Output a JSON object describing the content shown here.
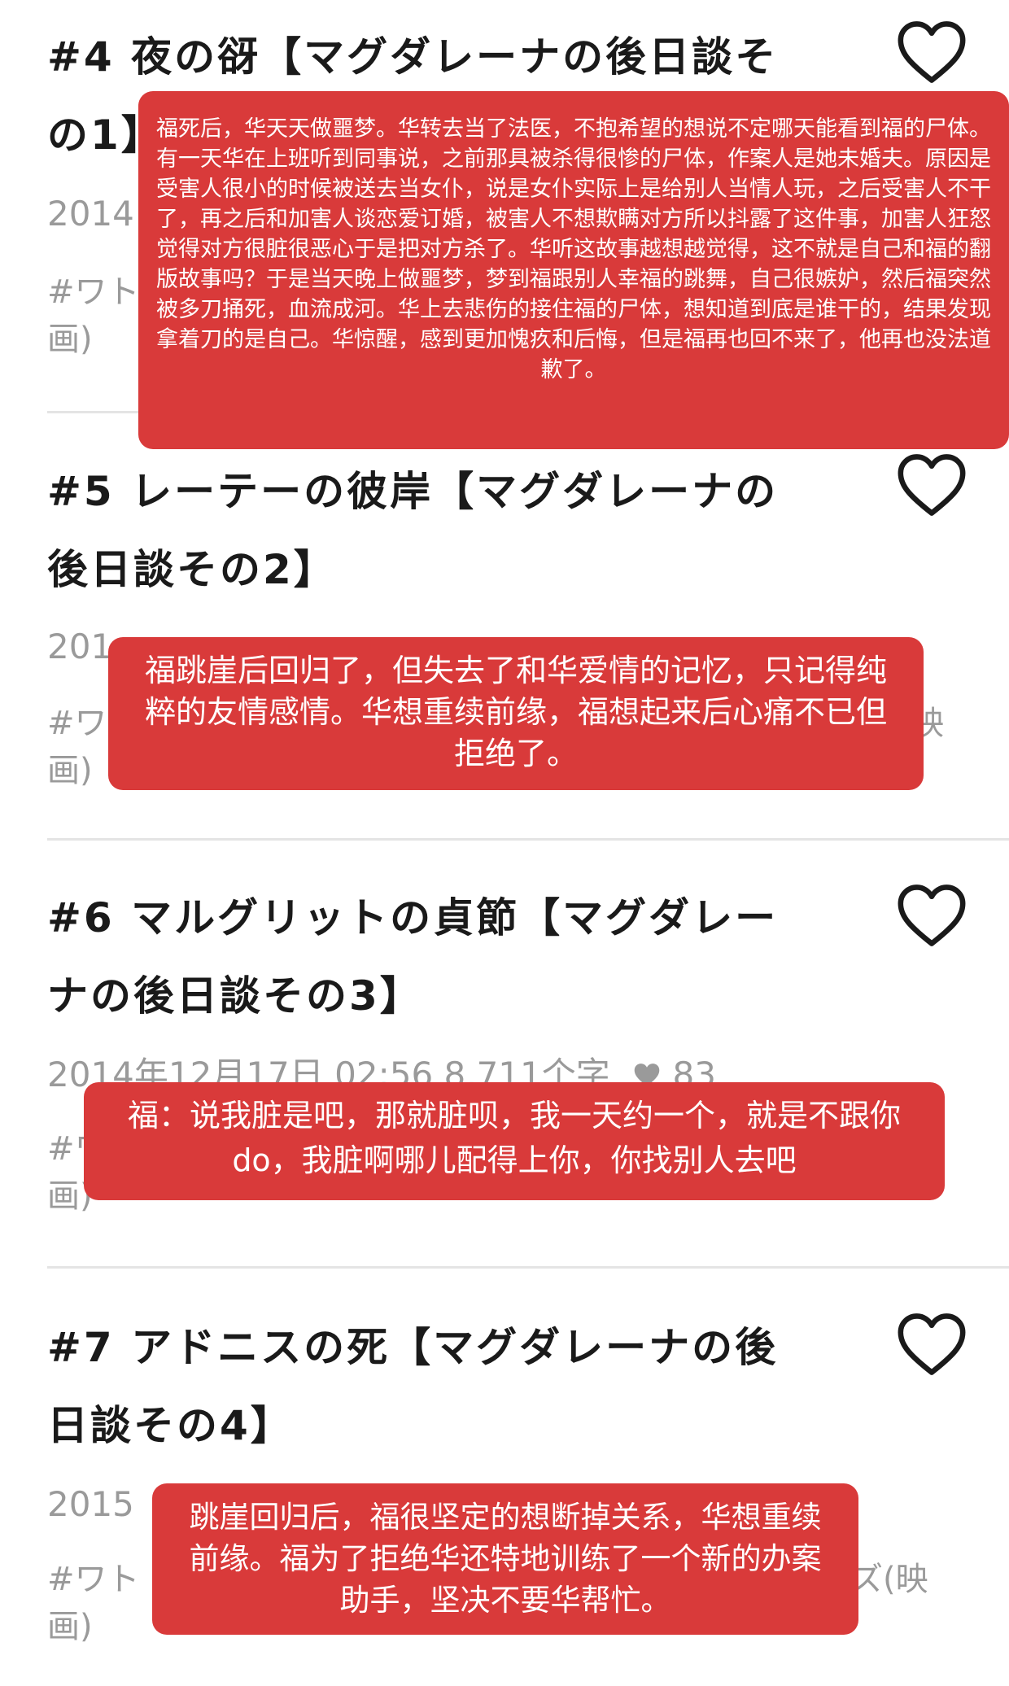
{
  "items": [
    {
      "title": "#4 夜の谺【マグダレーナの後日談その1】",
      "meta": "2014",
      "tags": "#ワト 画)"
    },
    {
      "title": "#5 レーテーの彼岸【マグダレーナの後日談その2】",
      "meta": "201",
      "tags_start": "#ワ",
      "tags_end": "映",
      "tags_line2": "画)"
    },
    {
      "title": "#6 マルグリットの貞節【マグダレーナの後日談その3】",
      "meta": "2014年12月17日 02:56 8,711个字",
      "likes": "83",
      "tags_start": "#ワ",
      "tags_line2": "画)"
    },
    {
      "title": "#7 アドニスの死【マグダレーナの後日談その4】",
      "meta": "2015",
      "tags_start": "#ワト",
      "tags_end": "ズ(映",
      "tags_line2": "画)"
    }
  ],
  "notes": [
    "福死后，华天天做噩梦。华转去当了法医，不抱希望的想说不定哪天能看到福的尸体。有一天华在上班听到同事说，之前那具被杀得很惨的尸体，作案人是她未婚夫。原因是受害人很小的时候被送去当女仆，说是女仆实际上是给别人当情人玩，之后受害人不干了，再之后和加害人谈恋爱订婚，被害人不想欺瞒对方所以抖露了这件事，加害人狂怒觉得对方很脏很恶心于是把对方杀了。华听这故事越想越觉得，这不就是自己和福的翻版故事吗？于是当天晚上做噩梦，梦到福跟别人幸福的跳舞，自己很嫉妒，然后福突然被多刀捅死，血流成河。华上去悲伤的接住福的尸体，想知道到底是谁干的，结果发现拿着刀的是自己。华惊醒，感到更加愧疚和后悔，但是福再也回不来了，他再也没法道歉了。",
    "福跳崖后回归了，但失去了和华爱情的记忆，只记得纯粹的友情感情。华想重续前缘，福想起来后心痛不已但拒绝了。",
    "福：说我脏是吧，那就脏呗，我一天约一个，就是不跟你do，我脏啊哪儿配得上你，你找别人去吧",
    "跳崖回归后，福很坚定的想断掉关系，华想重续前缘。福为了拒绝华还特地训练了一个新的办案助手，坚决不要华帮忙。"
  ],
  "colors": {
    "note_bg": "#d93a3a",
    "meta_gray": "#9a9a9a",
    "divider": "#e4e4e4"
  },
  "icons": {
    "like": "heart-outline-icon",
    "likes_count": "heart-filled-icon"
  }
}
